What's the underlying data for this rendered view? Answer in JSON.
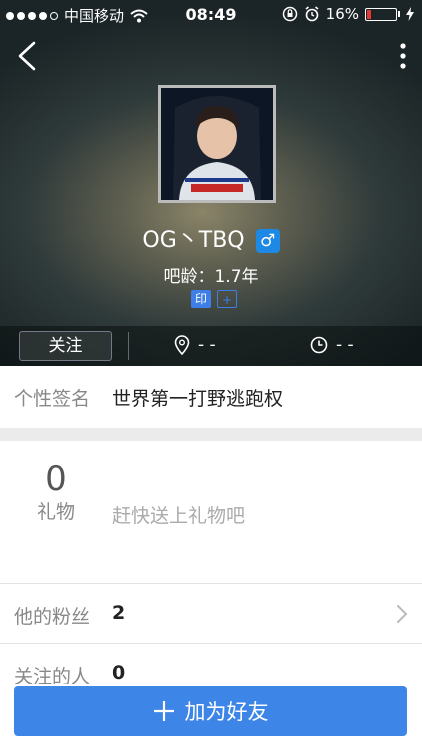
{
  "status_bar": {
    "carrier": "中国移动",
    "time": "08:49",
    "battery": "16%",
    "battery_level": 0.16,
    "battery_color": "#e53935"
  },
  "header": {
    "back_icon": "chevron-left-icon",
    "more_icon": "more-vertical-icon"
  },
  "profile": {
    "username": "OG丶TBQ",
    "gender_symbol": "♂",
    "gender_color": "#1e88e5",
    "tenure": "吧龄：1.7年",
    "badges": [
      "印",
      "+"
    ]
  },
  "actions": {
    "follow_label": "关注",
    "location_value": "- -",
    "last_active_value": "- -"
  },
  "signature": {
    "label": "个性签名",
    "value": "世界第一打野逃跑权"
  },
  "gifts": {
    "count": "0",
    "label": "礼物",
    "empty_text": "赶快送上礼物吧"
  },
  "fans": {
    "label": "他的粉丝",
    "count": "2"
  },
  "following": {
    "label": "关注的人",
    "count": "0"
  },
  "add_friend": {
    "label": "加为好友",
    "color": "#3d85e6"
  }
}
